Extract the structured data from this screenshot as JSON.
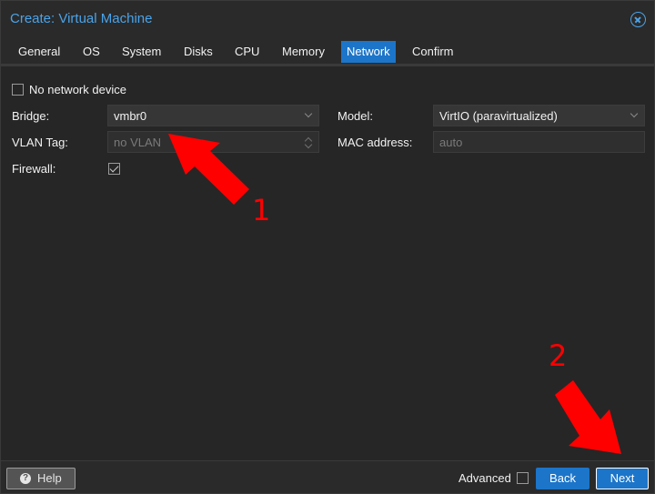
{
  "window": {
    "title": "Create: Virtual Machine"
  },
  "tabs": [
    {
      "label": "General"
    },
    {
      "label": "OS"
    },
    {
      "label": "System"
    },
    {
      "label": "Disks"
    },
    {
      "label": "CPU"
    },
    {
      "label": "Memory"
    },
    {
      "label": "Network",
      "active": true
    },
    {
      "label": "Confirm"
    }
  ],
  "form": {
    "no_network_device": {
      "label": "No network device",
      "checked": false
    },
    "bridge": {
      "label": "Bridge:",
      "value": "vmbr0"
    },
    "vlan_tag": {
      "label": "VLAN Tag:",
      "placeholder": "no VLAN"
    },
    "firewall": {
      "label": "Firewall:",
      "checked": true
    },
    "model": {
      "label": "Model:",
      "value": "VirtIO (paravirtualized)"
    },
    "mac_address": {
      "label": "MAC address:",
      "placeholder": "auto"
    }
  },
  "footer": {
    "help_label": "Help",
    "advanced_label": "Advanced",
    "advanced_checked": false,
    "back_label": "Back",
    "next_label": "Next"
  },
  "annotations": [
    {
      "number": "1"
    },
    {
      "number": "2"
    }
  ],
  "colors": {
    "accent": "#1c75c9",
    "title": "#4aa3e8",
    "annotation": "#ff0000"
  }
}
